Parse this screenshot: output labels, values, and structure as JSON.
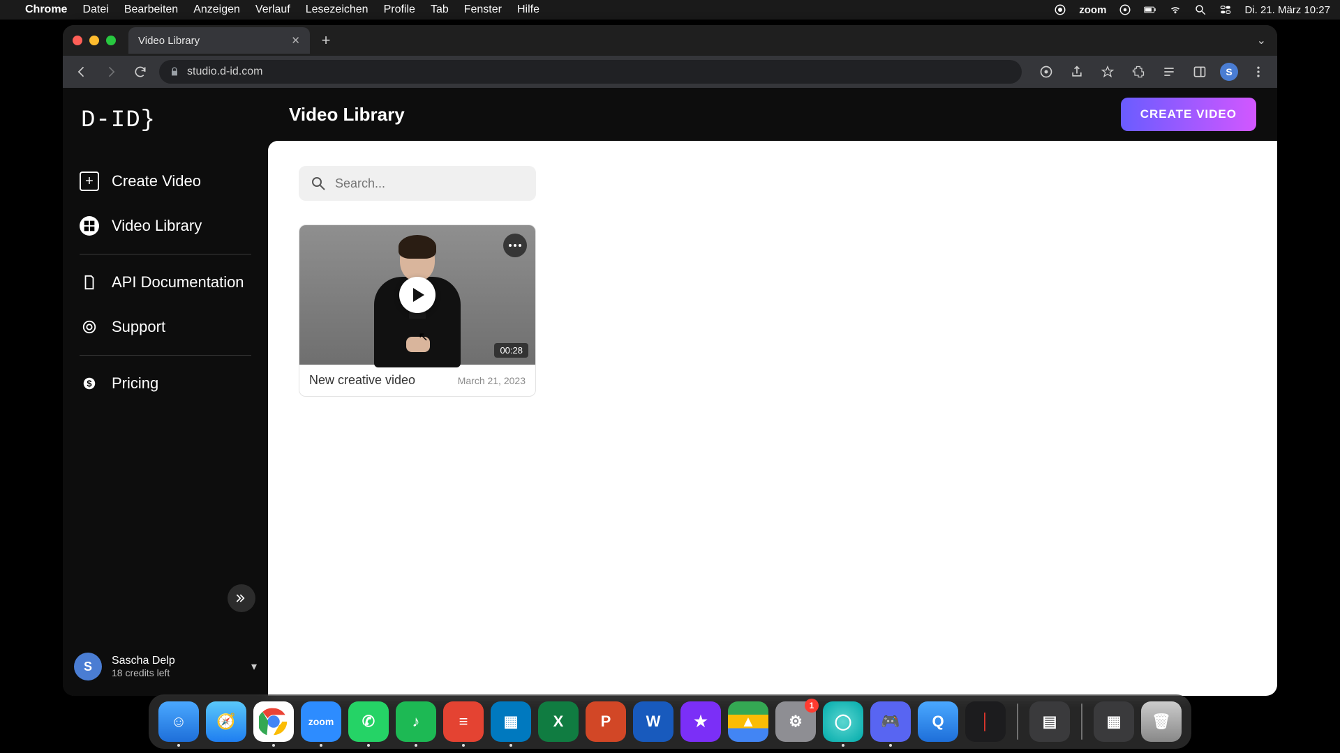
{
  "menubar": {
    "app": "Chrome",
    "items": [
      "Datei",
      "Bearbeiten",
      "Anzeigen",
      "Verlauf",
      "Lesezeichen",
      "Profile",
      "Tab",
      "Fenster",
      "Hilfe"
    ],
    "zoom_label": "zoom",
    "clock": "Di. 21. März  10:27"
  },
  "browser": {
    "tab_title": "Video Library",
    "url": "studio.d-id.com",
    "profile_initial": "S"
  },
  "app": {
    "logo": "D-ID}",
    "page_title": "Video Library",
    "create_button": "CREATE VIDEO",
    "nav": {
      "create": "Create Video",
      "library": "Video Library",
      "api": "API Documentation",
      "support": "Support",
      "pricing": "Pricing"
    },
    "user": {
      "initial": "S",
      "name": "Sascha Delp",
      "credits": "18 credits left"
    },
    "search_placeholder": "Search...",
    "videos": [
      {
        "title": "New creative video",
        "date": "March 21, 2023",
        "duration": "00:28"
      }
    ]
  },
  "dock": {
    "settings_badge": "1"
  }
}
